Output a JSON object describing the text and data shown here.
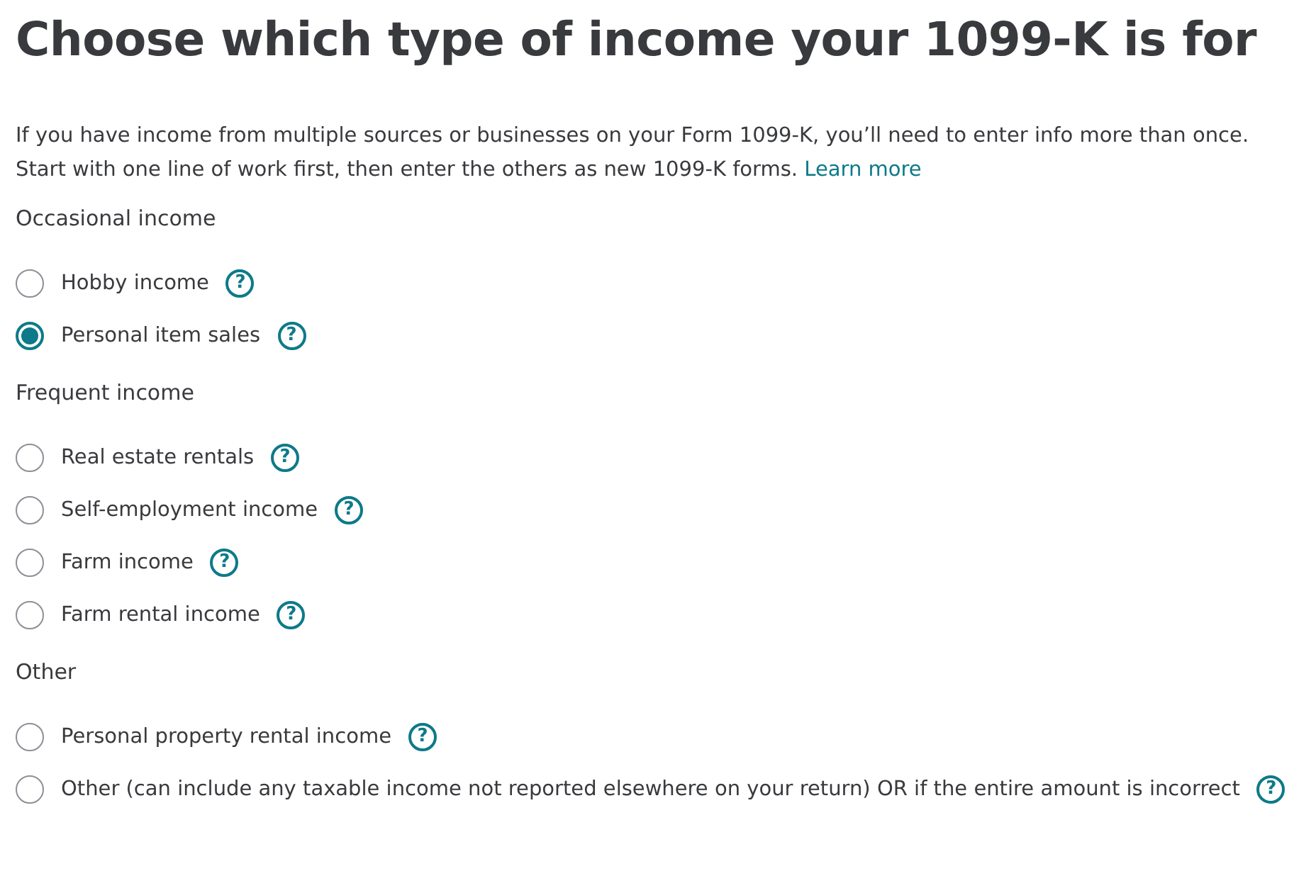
{
  "title": "Choose which type of income your 1099-K is for",
  "intro": {
    "text": "If you have income from multiple sources or businesses on your Form 1099-K, you’ll need to enter info more than once. Start with one line of work first, then enter the others as new 1099-K forms.",
    "link": "Learn more"
  },
  "groups": [
    {
      "heading": "Occasional income",
      "options": [
        {
          "label": "Hobby income",
          "help": "?",
          "selected": false
        },
        {
          "label": "Personal item sales",
          "help": "?",
          "selected": true
        }
      ]
    },
    {
      "heading": "Frequent income",
      "options": [
        {
          "label": "Real estate rentals",
          "help": "?",
          "selected": false
        },
        {
          "label": "Self-employment income",
          "help": "?",
          "selected": false
        },
        {
          "label": "Farm income",
          "help": "?",
          "selected": false
        },
        {
          "label": "Farm rental income",
          "help": "?",
          "selected": false
        }
      ]
    },
    {
      "heading": "Other",
      "options": [
        {
          "label": "Personal property rental income",
          "help": "?",
          "selected": false
        },
        {
          "label": "Other (can include any taxable income not reported elsewhere on your return) OR if the entire amount is incorrect",
          "help": "?",
          "selected": false
        }
      ]
    }
  ]
}
